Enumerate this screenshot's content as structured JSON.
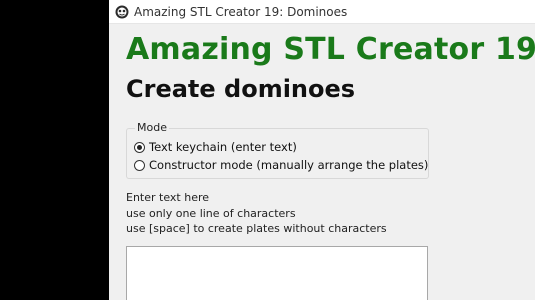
{
  "window": {
    "title": "Amazing STL Creator 19: Dominoes",
    "icon": "app-logo-icon"
  },
  "header": {
    "app_title": "Amazing STL Creator 19",
    "page_title": "Create dominoes"
  },
  "mode": {
    "legend": "Mode",
    "options": [
      {
        "label": "Text keychain (enter text)",
        "selected": true
      },
      {
        "label": "Constructor mode (manually arrange the plates)",
        "selected": false
      }
    ]
  },
  "instructions": {
    "line1": "Enter text here",
    "line2": "use only one line of characters",
    "line3": "use [space] to create plates without characters"
  },
  "text_input": {
    "value": ""
  },
  "colors": {
    "title_green": "#1a7a1a",
    "window_bg": "#f0f0f0",
    "desktop_bg": "#000000"
  }
}
